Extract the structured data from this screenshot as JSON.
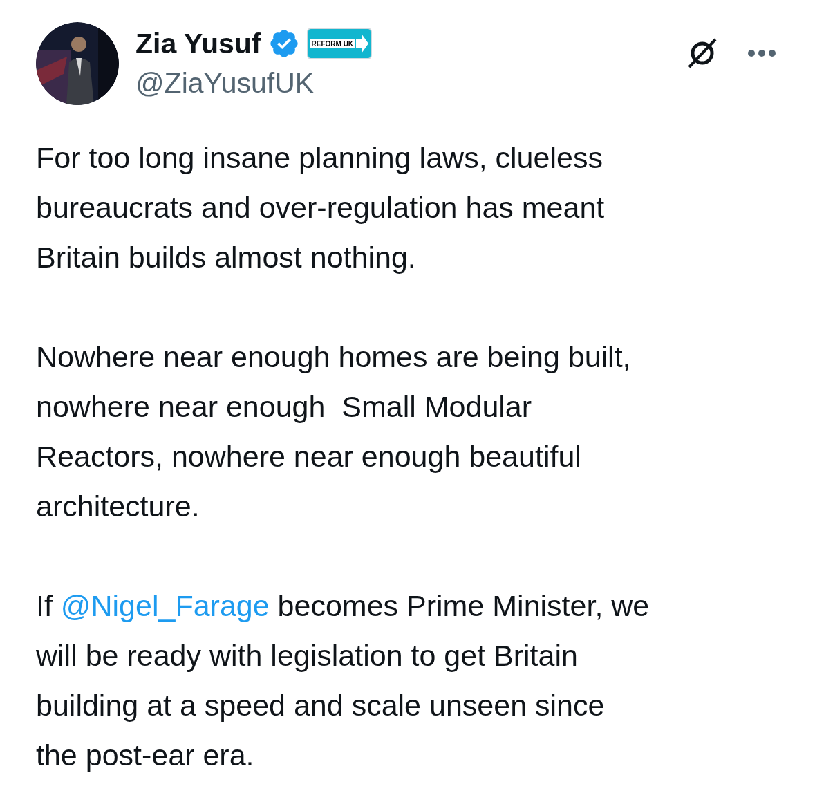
{
  "author": {
    "name": "Zia Yusuf",
    "verified": true,
    "affiliation_badge": "REFORM UK",
    "handle": "@ZiaYusufUK"
  },
  "paragraphs": [
    {
      "lines": [
        "For too long insane planning laws, clueless",
        "bureaucrats and over-regulation has meant",
        "Britain builds almost nothing."
      ]
    },
    {
      "lines": [
        "Nowhere near enough homes are being built,",
        "nowhere near enough  Small Modular",
        "Reactors, nowhere near enough beautiful",
        "architecture."
      ]
    },
    {
      "lines": [
        [
          {
            "kind": "text",
            "text": "If "
          },
          {
            "kind": "mention",
            "text": "@Nigel_Farage"
          },
          {
            "kind": "text",
            "text": " becomes Prime Minister, we"
          }
        ],
        "will be ready with legislation to get Britain",
        "building at a speed and scale unseen since",
        "the post-ear era."
      ]
    }
  ]
}
